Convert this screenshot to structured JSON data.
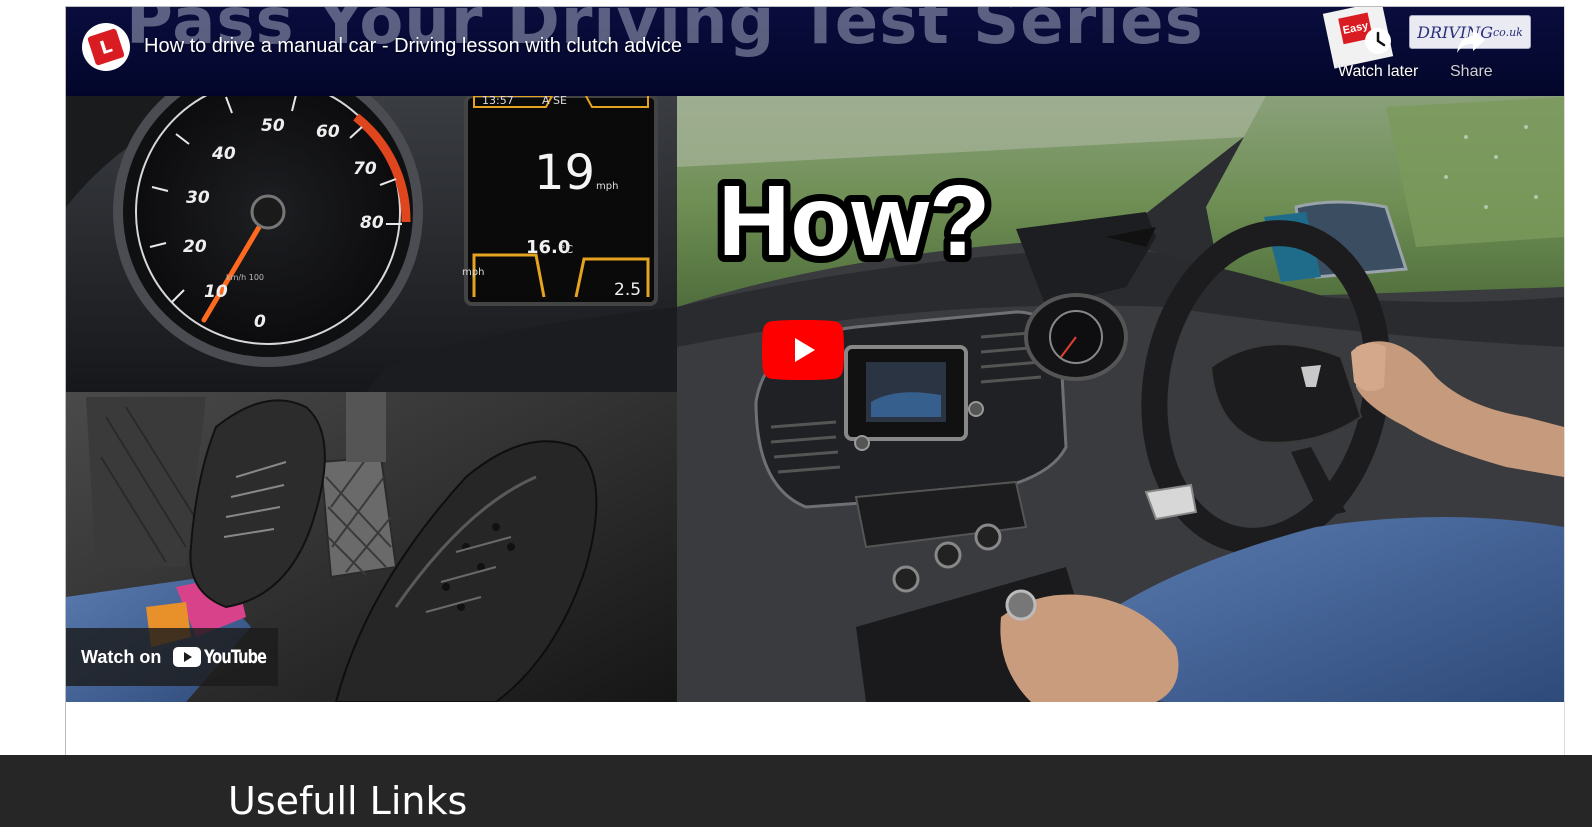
{
  "video": {
    "background_series_text": "Pass Your Driving Test Series",
    "title": "How to drive a manual car - Driving lesson with clutch advice",
    "channel_avatar_letter": "L",
    "channel_avatar_text": "Easy",
    "site_badge": "DRIVING",
    "site_badge_suffix": "co.uk",
    "watch_later_label": "Watch later",
    "share_label": "Share",
    "watch_on_label": "Watch on",
    "youtube_wordmark": "YouTube",
    "thumbnail": {
      "overlay_text": "How?",
      "speedo_ticks": [
        "10",
        "20",
        "30",
        "40",
        "50",
        "60",
        "70",
        "80"
      ],
      "speedo_zero": "0",
      "dash_time": "13:57",
      "dash_mode": "A SE",
      "dash_speed": "19",
      "dash_speed_unit": "mph",
      "dash_temp": "16.0",
      "dash_temp_unit": "°C",
      "dash_right_value": "2.5",
      "dash_left_label": "mph",
      "speedo_sublabel": "km/h 100"
    }
  },
  "footer": {
    "heading": "Usefull Links"
  },
  "colors": {
    "youtube_red": "#ff0000",
    "title_bar": "#03062a",
    "footer_bg": "#262626"
  }
}
